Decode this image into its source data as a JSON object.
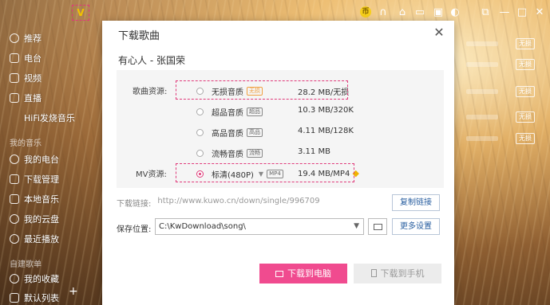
{
  "topbar": {
    "vip_icon": "diamond-icon",
    "coin_label": "币",
    "icons": [
      "coin-icon",
      "headphone-icon",
      "shirt-icon",
      "calendar-icon",
      "camera-icon",
      "skin-icon",
      "mini-mode-icon",
      "minimize-icon",
      "maximize-icon",
      "close-icon"
    ]
  },
  "sidebar": {
    "items": [
      {
        "label": "推荐",
        "icon": "recommend-icon"
      },
      {
        "label": "电台",
        "icon": "radio-icon"
      },
      {
        "label": "视频",
        "icon": "video-icon"
      },
      {
        "label": "直播",
        "icon": "live-icon"
      },
      {
        "label": "HiFi发烧音乐",
        "icon": ""
      },
      {
        "label": "我的电台",
        "icon": "my-radio-icon"
      },
      {
        "label": "下载管理",
        "icon": "download-icon"
      },
      {
        "label": "本地音乐",
        "icon": "local-music-icon"
      },
      {
        "label": "我的云盘",
        "icon": "cloud-icon"
      },
      {
        "label": "最近播放",
        "icon": "recent-icon"
      },
      {
        "label": "我的收藏",
        "icon": "heart-icon"
      },
      {
        "label": "默认列表",
        "icon": "list-icon"
      }
    ],
    "section_my_music": "我的音乐",
    "section_playlists": "自建歌单",
    "add_label": "+"
  },
  "right_badges": [
    "无损",
    "无损",
    "无损",
    "无损",
    "无损"
  ],
  "dialog": {
    "title": "下载歌曲",
    "close": "✕",
    "song": "有心人 - 张国荣",
    "song_source_label": "歌曲资源:",
    "mv_source_label": "MV资源:",
    "options": [
      {
        "name": "无损音质",
        "tag": "无损",
        "size": "28.2 MB/无损",
        "selected": false
      },
      {
        "name": "超品音质",
        "tag": "超品",
        "size": "10.3 MB/320K",
        "selected": false
      },
      {
        "name": "高品音质",
        "tag": "高品",
        "size": "4.11 MB/128K",
        "selected": false
      },
      {
        "name": "流畅音质",
        "tag": "流畅",
        "size": "3.11 MB",
        "selected": false
      }
    ],
    "mv": {
      "name": "标清(480P)",
      "format": "MP4",
      "size": "19.4 MB/MP4",
      "selected": true
    },
    "download_link_label": "下载链接:",
    "download_link": "http://www.kuwo.cn/down/single/996709",
    "copy_link": "复制链接",
    "save_label": "保存位置:",
    "save_path": "C:\\KwDownload\\song\\",
    "more_settings": "更多设置",
    "download_pc": "下载到电脑",
    "download_phone": "下载到手机"
  }
}
